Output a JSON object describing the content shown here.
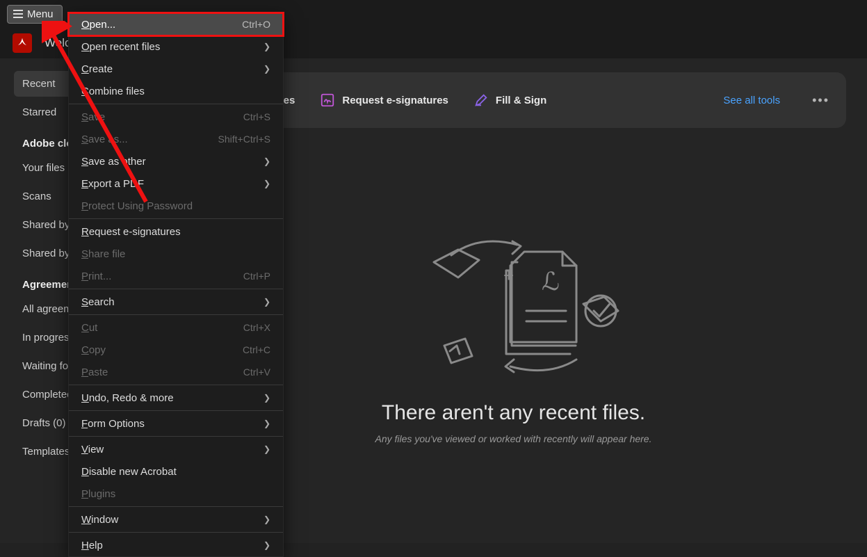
{
  "titlebar": {
    "menu_label": "Menu"
  },
  "tab": {
    "title": "Welcome"
  },
  "sidebar": {
    "items_top": [
      "Recent",
      "Starred"
    ],
    "sections": [
      {
        "heading": "Adobe cloud storage",
        "items": [
          "Your files",
          "Scans",
          "Shared by you",
          "Shared by others"
        ]
      },
      {
        "heading": "Agreements",
        "items": [
          "All agreements",
          "In progress",
          "Waiting for you",
          "Completed",
          "Drafts (0)",
          "Templates"
        ]
      }
    ]
  },
  "toolbar": {
    "tools": [
      {
        "id": "combine",
        "label": "Combine files",
        "icon": "combine-icon",
        "color": "#9a5cff"
      },
      {
        "id": "request",
        "label": "Request e-signatures",
        "icon": "signature-icon",
        "color": "#c056d6"
      },
      {
        "id": "fillsign",
        "label": "Fill & Sign",
        "icon": "pencil-icon",
        "color": "#8a63e6"
      }
    ],
    "see_all_label": "See all tools"
  },
  "empty_state": {
    "title": "There aren't any recent files.",
    "subtitle": "Any files you've viewed or worked with recently will appear here."
  },
  "menu": {
    "items": [
      {
        "label": "Open...",
        "shortcut": "Ctrl+O",
        "highlight": true
      },
      {
        "label": "Open recent files",
        "submenu": true
      },
      {
        "label": "Create",
        "submenu": true
      },
      {
        "label": "Combine files"
      },
      {
        "sep": true
      },
      {
        "label": "Save",
        "shortcut": "Ctrl+S",
        "disabled": true
      },
      {
        "label": "Save as...",
        "shortcut": "Shift+Ctrl+S",
        "disabled": true
      },
      {
        "label": "Save as other",
        "submenu": true
      },
      {
        "label": "Export a PDF",
        "submenu": true
      },
      {
        "label": "Protect Using Password",
        "disabled": true
      },
      {
        "sep": true
      },
      {
        "label": "Request e-signatures"
      },
      {
        "label": "Share file",
        "disabled": true
      },
      {
        "label": "Print...",
        "shortcut": "Ctrl+P",
        "disabled": true
      },
      {
        "sep": true
      },
      {
        "label": "Search",
        "submenu": true
      },
      {
        "sep": true
      },
      {
        "label": "Cut",
        "shortcut": "Ctrl+X",
        "disabled": true
      },
      {
        "label": "Copy",
        "shortcut": "Ctrl+C",
        "disabled": true
      },
      {
        "label": "Paste",
        "shortcut": "Ctrl+V",
        "disabled": true
      },
      {
        "sep": true
      },
      {
        "label": "Undo, Redo & more",
        "submenu": true
      },
      {
        "sep": true
      },
      {
        "label": "Form Options",
        "submenu": true
      },
      {
        "sep": true
      },
      {
        "label": "View",
        "submenu": true
      },
      {
        "label": "Disable new Acrobat"
      },
      {
        "label": "Plugins",
        "disabled": true
      },
      {
        "sep": true
      },
      {
        "label": "Window",
        "submenu": true
      },
      {
        "sep": true
      },
      {
        "label": "Help",
        "submenu": true
      }
    ]
  },
  "colors": {
    "accent_blue": "#4aa3ff",
    "highlight_red": "#e11",
    "app_red": "#b30b00"
  }
}
